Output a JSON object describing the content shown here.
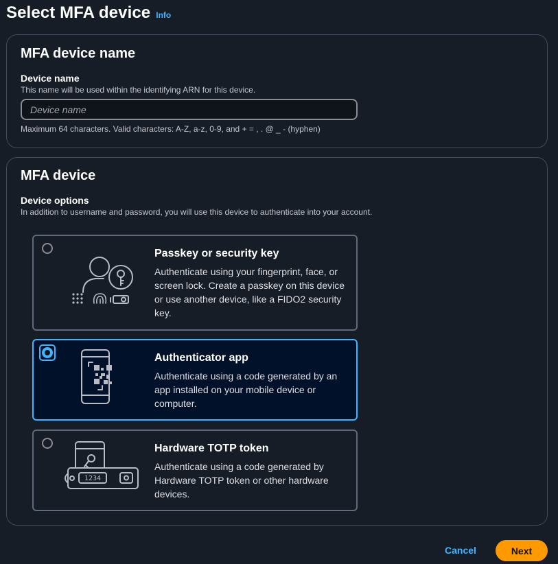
{
  "header": {
    "title": "Select MFA device",
    "info_label": "Info"
  },
  "name_section": {
    "title": "MFA device name",
    "field_label": "Device name",
    "field_description": "This name will be used within the identifying ARN for this device.",
    "input_value": "",
    "input_placeholder": "Device name",
    "constraint_text": "Maximum 64 characters. Valid characters: A-Z, a-z, 0-9, and + = , . @ _ - (hyphen)"
  },
  "device_section": {
    "title": "MFA device",
    "options_label": "Device options",
    "options_description": "In addition to username and password, you will use this device to authenticate into your account.",
    "options": [
      {
        "title": "Passkey or security key",
        "description": "Authenticate using your fingerprint, face, or screen lock. Create a passkey on this device or use another device, like a FIDO2 security key.",
        "selected": false,
        "icon": "passkey-icon"
      },
      {
        "title": "Authenticator app",
        "description": "Authenticate using a code generated by an app installed on your mobile device or computer.",
        "selected": true,
        "icon": "authenticator-app-icon"
      },
      {
        "title": "Hardware TOTP token",
        "description": "Authenticate using a code generated by Hardware TOTP token or other hardware devices.",
        "selected": false,
        "icon": "hardware-token-icon",
        "token_display": "1234"
      }
    ]
  },
  "footer": {
    "cancel_label": "Cancel",
    "next_label": "Next"
  },
  "colors": {
    "background": "#161d26",
    "accent": "#42b4ff",
    "primary_button": "#ff9900",
    "selected_card": "#001129",
    "border": "#5f6b7a"
  }
}
